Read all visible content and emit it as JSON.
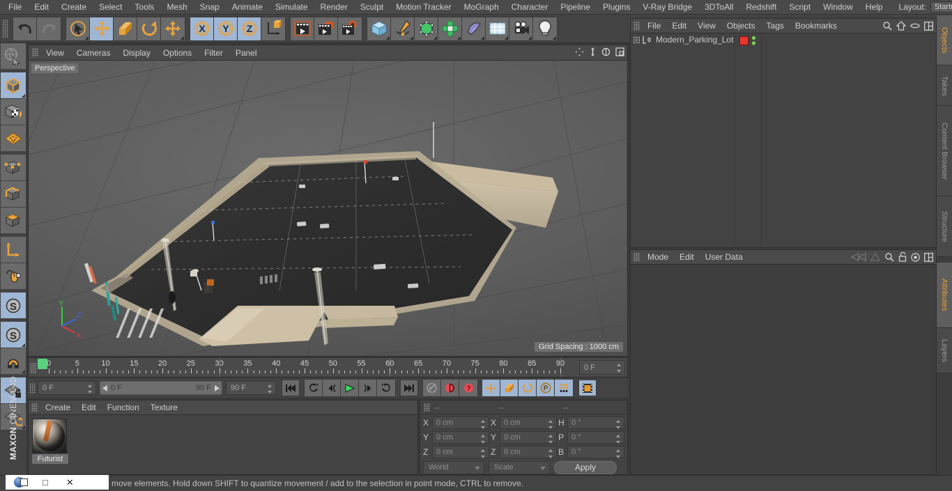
{
  "menubar": {
    "items": [
      "File",
      "Edit",
      "Create",
      "Select",
      "Tools",
      "Mesh",
      "Snap",
      "Animate",
      "Simulate",
      "Render",
      "Sculpt",
      "Motion Tracker",
      "MoGraph",
      "Character",
      "Pipeline",
      "Plugins",
      "V-Ray Bridge",
      "3DToAll",
      "Redshift",
      "Script",
      "Window",
      "Help"
    ],
    "layout_label": "Layout:",
    "layout_value": "Startup",
    "search_icon": "search-icon"
  },
  "toolbar": {
    "groups": [
      {
        "name": "history",
        "buttons": [
          {
            "icon": "undo-icon",
            "selected": false,
            "corner": false
          },
          {
            "icon": "redo-icon",
            "selected": false,
            "corner": false
          }
        ]
      },
      {
        "name": "transform",
        "buttons": [
          {
            "icon": "select-cursor-icon",
            "selected": false,
            "corner": true
          },
          {
            "icon": "move-icon",
            "selected": true,
            "corner": false
          },
          {
            "icon": "scale-icon",
            "selected": false,
            "corner": false
          },
          {
            "icon": "rotate-icon",
            "selected": false,
            "corner": false
          },
          {
            "icon": "move-alt-icon",
            "selected": false,
            "corner": true
          }
        ]
      },
      {
        "name": "axis-lock",
        "buttons": [
          {
            "icon": "x-axis-icon",
            "selected": true,
            "corner": false
          },
          {
            "icon": "y-axis-icon",
            "selected": true,
            "corner": false
          },
          {
            "icon": "z-axis-icon",
            "selected": true,
            "corner": false
          },
          {
            "icon": "world-axis-icon",
            "selected": false,
            "corner": false
          }
        ]
      },
      {
        "name": "render",
        "buttons": [
          {
            "icon": "render-view-icon",
            "selected": false,
            "corner": false
          },
          {
            "icon": "render-picture-viewer-icon",
            "selected": false,
            "corner": false
          },
          {
            "icon": "render-settings-icon",
            "selected": false,
            "corner": false
          }
        ]
      },
      {
        "name": "create",
        "buttons": [
          {
            "icon": "cube-primitive-icon",
            "selected": false,
            "corner": true
          },
          {
            "icon": "spline-pen-icon",
            "selected": false,
            "corner": true
          },
          {
            "icon": "generator-nurbs-icon",
            "selected": false,
            "corner": true
          },
          {
            "icon": "deformer-icon",
            "selected": false,
            "corner": true
          },
          {
            "icon": "scene-object-icon",
            "selected": false,
            "corner": true
          },
          {
            "icon": "floor-environment-icon",
            "selected": false,
            "corner": true
          },
          {
            "icon": "camera-icon",
            "selected": false,
            "corner": true
          },
          {
            "icon": "light-icon",
            "selected": false,
            "corner": true
          }
        ]
      }
    ]
  },
  "left_toolbar": {
    "buttons": [
      {
        "icon": "live-selection-icon",
        "selected": false,
        "corner": false
      },
      {
        "icon": "model-mode-icon",
        "selected": true,
        "corner": true
      },
      {
        "icon": "texture-mode-icon",
        "selected": false,
        "corner": false
      },
      {
        "icon": "workplane-mode-icon",
        "selected": false,
        "corner": false
      },
      {
        "icon": "point-mode-icon",
        "selected": false,
        "corner": false
      },
      {
        "icon": "edge-mode-icon",
        "selected": false,
        "corner": false
      },
      {
        "icon": "polygon-mode-icon",
        "selected": false,
        "corner": false
      },
      {
        "icon": "axis-modify-icon",
        "selected": false,
        "corner": false
      },
      {
        "icon": "enable-axis-icon",
        "selected": false,
        "corner": false
      },
      {
        "icon": "viewport-solo-icon",
        "selected": true,
        "corner": false
      },
      {
        "icon": "snap-s-icon",
        "selected": true,
        "corner": true
      },
      {
        "icon": "magnet-icon",
        "selected": false,
        "corner": true
      },
      {
        "icon": "workplane-lock-icon",
        "selected": true,
        "corner": false
      },
      {
        "icon": "workplane-rotate-icon",
        "selected": false,
        "corner": true
      }
    ],
    "brand_bold": "MAXON",
    "brand_text": "CINEMA 4D"
  },
  "viewport": {
    "menu": [
      "View",
      "Cameras",
      "Display",
      "Options",
      "Filter",
      "Panel"
    ],
    "corner_icons": [
      "pan-icon",
      "dolly-icon",
      "orbit-icon",
      "maximize-icon"
    ],
    "perspective_label": "Perspective",
    "grid_spacing": "Grid Spacing : 1000 cm",
    "axis": {
      "x": "X",
      "y": "Y",
      "z": "Z"
    },
    "scene_description": "Modern parking lot with asphalt surface, light poles, crosswalk and curb"
  },
  "timeline": {
    "start": 0,
    "end": 90,
    "labels": [
      0,
      5,
      10,
      15,
      20,
      25,
      30,
      35,
      40,
      45,
      50,
      55,
      60,
      65,
      70,
      75,
      80,
      85,
      90
    ],
    "current_frame_field": "0 F",
    "playhead_frame": 0
  },
  "playback": {
    "current_frame": "0 F",
    "range_start": "0 F",
    "range_end": "90 F",
    "end_frame": "90 F",
    "transport": [
      {
        "icon": "go-to-start-icon",
        "selected": false
      },
      {
        "icon": "previous-keyframe-icon",
        "selected": false
      },
      {
        "icon": "step-back-icon",
        "selected": false
      },
      {
        "icon": "play-icon",
        "selected": false
      },
      {
        "icon": "step-forward-icon",
        "selected": false
      },
      {
        "icon": "next-keyframe-icon",
        "selected": false
      },
      {
        "icon": "go-to-end-icon",
        "selected": false
      }
    ],
    "record_group": [
      {
        "icon": "autokey-icon",
        "selected": false
      },
      {
        "icon": "record-active-objects-icon",
        "selected": false
      },
      {
        "icon": "record-keyframe-icon",
        "selected": false
      }
    ],
    "keyframe_group": [
      {
        "icon": "key-position-icon",
        "selected": true
      },
      {
        "icon": "key-scale-icon",
        "selected": true
      },
      {
        "icon": "key-rotation-icon",
        "selected": true
      },
      {
        "icon": "key-parameter-icon",
        "selected": true
      },
      {
        "icon": "key-point-level-icon",
        "selected": true
      }
    ],
    "timeline_toggle": {
      "icon": "timeline-icon",
      "selected": true
    }
  },
  "material_manager": {
    "menu": [
      "Create",
      "Edit",
      "Function",
      "Texture"
    ],
    "materials": [
      {
        "name": "Futurist",
        "selected": true
      }
    ]
  },
  "coordinates": {
    "headers": [
      "--",
      "--",
      "--"
    ],
    "rows": [
      {
        "pos_label": "X",
        "pos_value": "0 cm",
        "size_label": "X",
        "size_value": "0 cm",
        "rot_label": "H",
        "rot_value": "0 °"
      },
      {
        "pos_label": "Y",
        "pos_value": "0 cm",
        "size_label": "Y",
        "size_value": "0 cm",
        "rot_label": "P",
        "rot_value": "0 °"
      },
      {
        "pos_label": "Z",
        "pos_value": "0 cm",
        "size_label": "Z",
        "size_value": "0 cm",
        "rot_label": "B",
        "rot_value": "0 °"
      }
    ],
    "system_dropdown": "World",
    "mode_dropdown": "Scale",
    "apply_label": "Apply"
  },
  "object_manager": {
    "menu": [
      "File",
      "Edit",
      "View",
      "Objects",
      "Tags",
      "Bookmarks"
    ],
    "icons": [
      "search-icon",
      "home-icon",
      "ellipse-icon",
      "layout-icon"
    ],
    "objects": [
      {
        "name": "Modern_Parking_Lot",
        "layer_badge": "0",
        "tag_color": "#e8372e",
        "visibility_top": "#7bd35a",
        "visibility_bottom": "#7bd35a"
      }
    ]
  },
  "attribute_manager": {
    "menu": [
      "Mode",
      "Edit",
      "User Data"
    ],
    "icons": [
      "history-back-icon",
      "history-forward-icon",
      "search-icon",
      "lock-icon",
      "target-icon",
      "layout-icon"
    ]
  },
  "dock_tabs_top": [
    {
      "label": "Objects",
      "active": true
    },
    {
      "label": "Takes",
      "active": false
    },
    {
      "label": "Content Browser",
      "active": false
    },
    {
      "label": "Structure",
      "active": false
    }
  ],
  "dock_tabs_bottom": [
    {
      "label": "Attributes",
      "active": true
    },
    {
      "label": "Layers",
      "active": false
    }
  ],
  "statusbar": {
    "text": "move elements. Hold down SHIFT to quantize movement / add to the selection in point mode, CTRL to remove.",
    "window_controls": [
      "app-orb-icon",
      "restore-icon",
      "minimize-icon",
      "close-icon"
    ]
  },
  "colors": {
    "accent_orange": "#e8a33d",
    "selection_blue": "#9fb6d4",
    "panel_bg": "#434343",
    "menu_bg": "#4a4a4a",
    "tag_red": "#e8372e",
    "playhead_green": "#5ad17f"
  }
}
